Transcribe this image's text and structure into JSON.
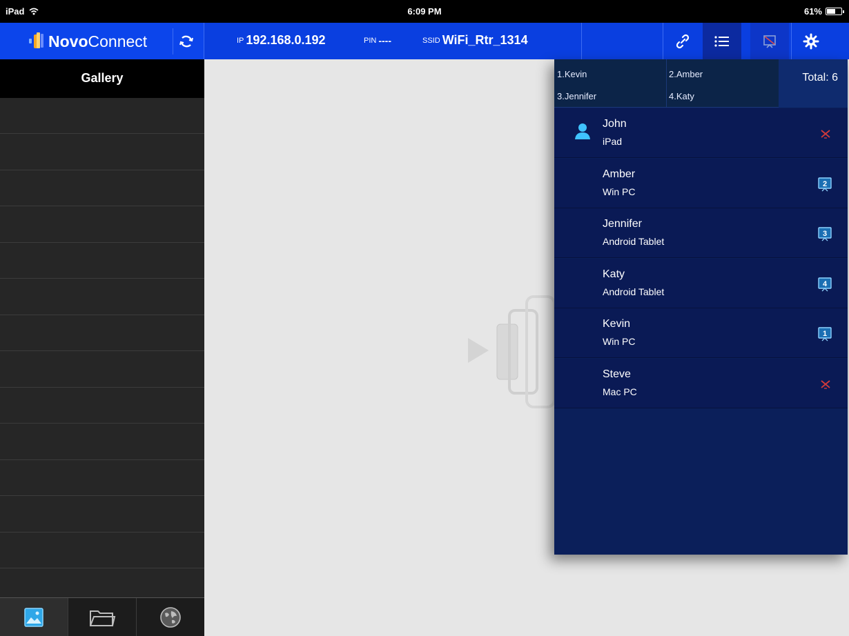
{
  "status_bar": {
    "device": "iPad",
    "time": "6:09 PM",
    "battery": "61%",
    "battery_level": 0.61
  },
  "header": {
    "app_name_bold": "Novo",
    "app_name_light": "Connect",
    "ip_label": "IP",
    "ip_value": "192.168.0.192",
    "pin_label": "PIN",
    "pin_value": "----",
    "ssid_label": "SSID",
    "ssid_value": "WiFi_Rtr_1314",
    "buttons": [
      {
        "name": "link-icon",
        "state": "normal"
      },
      {
        "name": "list-icon",
        "state": "active"
      },
      {
        "name": "screen-off-icon",
        "state": "normal"
      },
      {
        "name": "gear-icon",
        "state": "normal"
      }
    ]
  },
  "sidebar": {
    "title": "Gallery",
    "tabs": [
      {
        "icon": "image-icon",
        "active": true
      },
      {
        "icon": "folder-icon",
        "active": false
      },
      {
        "icon": "globe-icon",
        "active": false
      }
    ]
  },
  "participants_panel": {
    "presenters": [
      "1.Kevin",
      "2.Amber",
      "3.Jennifer",
      "4.Katy"
    ],
    "total": "Total: 6",
    "users": [
      {
        "name": "John",
        "device": "iPad",
        "is_self": true,
        "slot": null
      },
      {
        "name": "Amber",
        "device": "Win PC",
        "is_self": false,
        "slot": "2"
      },
      {
        "name": "Jennifer",
        "device": "Android Tablet",
        "is_self": false,
        "slot": "3"
      },
      {
        "name": "Katy",
        "device": "Android Tablet",
        "is_self": false,
        "slot": "4"
      },
      {
        "name": "Kevin",
        "device": "Win PC",
        "is_self": false,
        "slot": "1"
      },
      {
        "name": "Steve",
        "device": "Mac PC",
        "is_self": false,
        "slot": null
      }
    ]
  },
  "colors": {
    "header_blue": "#0a3fe0",
    "panel_navy": "#0b1f5a",
    "accent_cyan": "#3fc3ff",
    "offline_red": "#d23a3a"
  }
}
